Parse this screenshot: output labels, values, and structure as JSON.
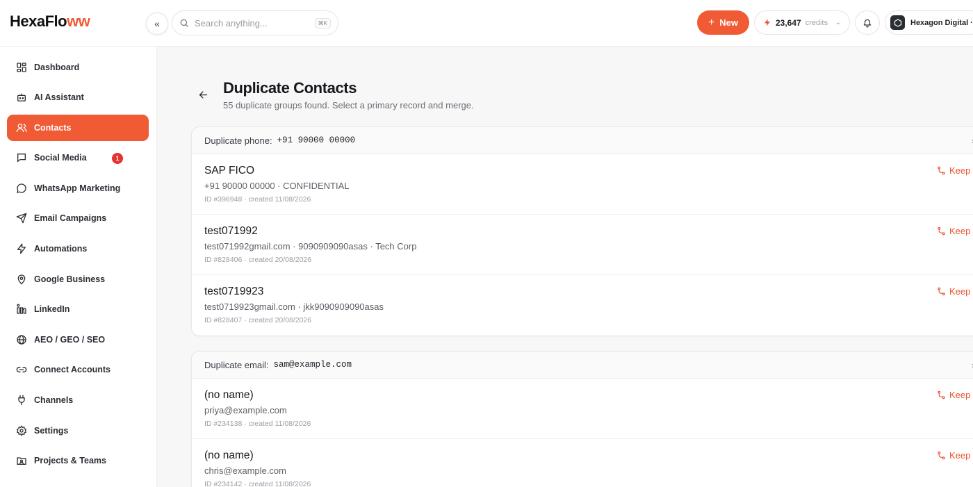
{
  "app": {
    "logo_main": "HexaFlo",
    "logo_accent": "ww"
  },
  "topbar": {
    "search_placeholder": "Search anything...",
    "search_shortcut": "⌘K",
    "new_label": "New",
    "credits_amount": "23,647",
    "credits_unit": "credits",
    "workspace_name": "Hexagon Digital · D"
  },
  "sidebar": {
    "items": [
      {
        "label": "Dashboard",
        "icon": "dashboard-icon"
      },
      {
        "label": "AI Assistant",
        "icon": "robot-icon"
      },
      {
        "label": "Contacts",
        "icon": "users-icon",
        "active": true
      },
      {
        "label": "Social Media",
        "icon": "chat-icon",
        "badge": "1"
      },
      {
        "label": "WhatsApp Marketing",
        "icon": "whatsapp-icon"
      },
      {
        "label": "Email Campaigns",
        "icon": "send-icon"
      },
      {
        "label": "Automations",
        "icon": "bolt-icon"
      },
      {
        "label": "Google Business",
        "icon": "map-pin-icon"
      },
      {
        "label": "LinkedIn",
        "icon": "linkedin-icon"
      },
      {
        "label": "AEO / GEO / SEO",
        "icon": "globe-icon"
      },
      {
        "label": "Connect Accounts",
        "icon": "link-icon"
      },
      {
        "label": "Channels",
        "icon": "plug-icon"
      },
      {
        "label": "Settings",
        "icon": "gear-icon"
      },
      {
        "label": "Projects & Teams",
        "icon": "folder-users-icon"
      }
    ]
  },
  "page": {
    "title": "Duplicate Contacts",
    "subtitle": "55 duplicate groups found. Select a primary record and merge."
  },
  "groups": [
    {
      "label": "Duplicate phone:",
      "value": "+91 90000 00000",
      "contacts": [
        {
          "name": "SAP FICO",
          "detail": "+91 90000 00000 · CONFIDENTIAL",
          "meta": "ID #396948 · created 11/08/2026",
          "action": "Keep"
        },
        {
          "name": "test071992",
          "detail": "test071992gmail.com · 9090909090asas · Tech Corp",
          "meta": "ID #828406 · created 20/08/2026",
          "action": "Keep"
        },
        {
          "name": "test0719923",
          "detail": "test0719923gmail.com · jkk9090909090asas",
          "meta": "ID #828407 · created 20/08/2026",
          "action": "Keep"
        }
      ]
    },
    {
      "label": "Duplicate email:",
      "value": "sam@example.com",
      "contacts": [
        {
          "name": "(no name)",
          "detail": "priya@example.com",
          "meta": "ID #234138 · created 11/08/2026",
          "action": "Keep"
        },
        {
          "name": "(no name)",
          "detail": "chris@example.com",
          "meta": "ID #234142 · created 11/08/2026",
          "action": "Keep"
        }
      ]
    }
  ]
}
